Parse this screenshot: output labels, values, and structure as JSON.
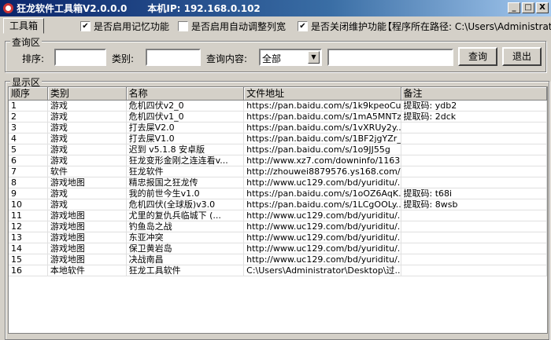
{
  "title": "狂龙软件工具箱V2.0.0.0",
  "ip": "本机IP: 192.168.0.102",
  "window_buttons": [
    "_",
    "□",
    "X"
  ],
  "tab": "工具箱",
  "options": [
    {
      "label": "是否启用记忆功能",
      "checked": true
    },
    {
      "label": "是否启用自动调整列宽",
      "checked": false
    },
    {
      "label": "是否关闭维护功能",
      "checked": true
    }
  ],
  "path_text": "【程序所在路径: C:\\Users\\Administrator",
  "query": {
    "legend": "查询区",
    "sort_label": "排序:",
    "sort_value": "",
    "type_label": "类别:",
    "type_value": "",
    "content_label": "查询内容:",
    "content_select": "全部",
    "search_value": "",
    "search_button": "查询",
    "exit_button": "退出"
  },
  "display": {
    "legend": "显示区",
    "columns": [
      "顺序",
      "类别",
      "名称",
      "文件地址",
      "备注"
    ],
    "rows": [
      [
        "1",
        "游戏",
        "危机四伏v2_0",
        "https://pan.baidu.com/s/1k9kpeoCu...",
        "提取码: ydb2"
      ],
      [
        "2",
        "游戏",
        "危机四伏v1_0",
        "https://pan.baidu.com/s/1mA5MNTz...",
        "提取码: 2dck"
      ],
      [
        "3",
        "游戏",
        "打去屎V2.0",
        "https://pan.baidu.com/s/1vXRUy2y...",
        ""
      ],
      [
        "4",
        "游戏",
        "打去屎V1.0",
        "https://pan.baidu.com/s/1BF2jgYZr_...",
        ""
      ],
      [
        "5",
        "游戏",
        "迟到 v5.1.8 安卓版",
        "https://pan.baidu.com/s/1o9JJ55g",
        ""
      ],
      [
        "6",
        "游戏",
        "狂龙变形金刚之连连看v...",
        "http://www.xz7.com/downinfo/1163...",
        ""
      ],
      [
        "7",
        "软件",
        "狂龙软件",
        "http://zhouwei8879576.ys168.com/",
        ""
      ],
      [
        "8",
        "游戏地图",
        "精忠报国之狂龙传",
        "http://www.uc129.com/bd/yuriditu/...",
        ""
      ],
      [
        "9",
        "游戏",
        "我的前世今生v1.0",
        "https://pan.baidu.com/s/1oOZ6AqK...",
        "提取码: t68i"
      ],
      [
        "10",
        "游戏",
        "危机四伏(全球版)v3.0",
        "https://pan.baidu.com/s/1LCgOOLy...",
        "提取码: 8wsb"
      ],
      [
        "11",
        "游戏地图",
        "尤里的复仇兵临城下 (...",
        "http://www.uc129.com/bd/yuriditu/...",
        ""
      ],
      [
        "12",
        "游戏地图",
        "钓鱼岛之战",
        "http://www.uc129.com/bd/yuriditu/...",
        ""
      ],
      [
        "13",
        "游戏地图",
        "东亚冲突",
        "http://www.uc129.com/bd/yuriditu/...",
        ""
      ],
      [
        "14",
        "游戏地图",
        "保卫黄岩岛",
        "http://www.uc129.com/bd/yuriditu/...",
        ""
      ],
      [
        "15",
        "游戏地图",
        "决战南昌",
        "http://www.uc129.com/bd/yuriditu/...",
        ""
      ],
      [
        "16",
        "本地软件",
        "狂龙工具软件",
        "C:\\Users\\Administrator\\Desktop\\过...",
        ""
      ]
    ]
  }
}
